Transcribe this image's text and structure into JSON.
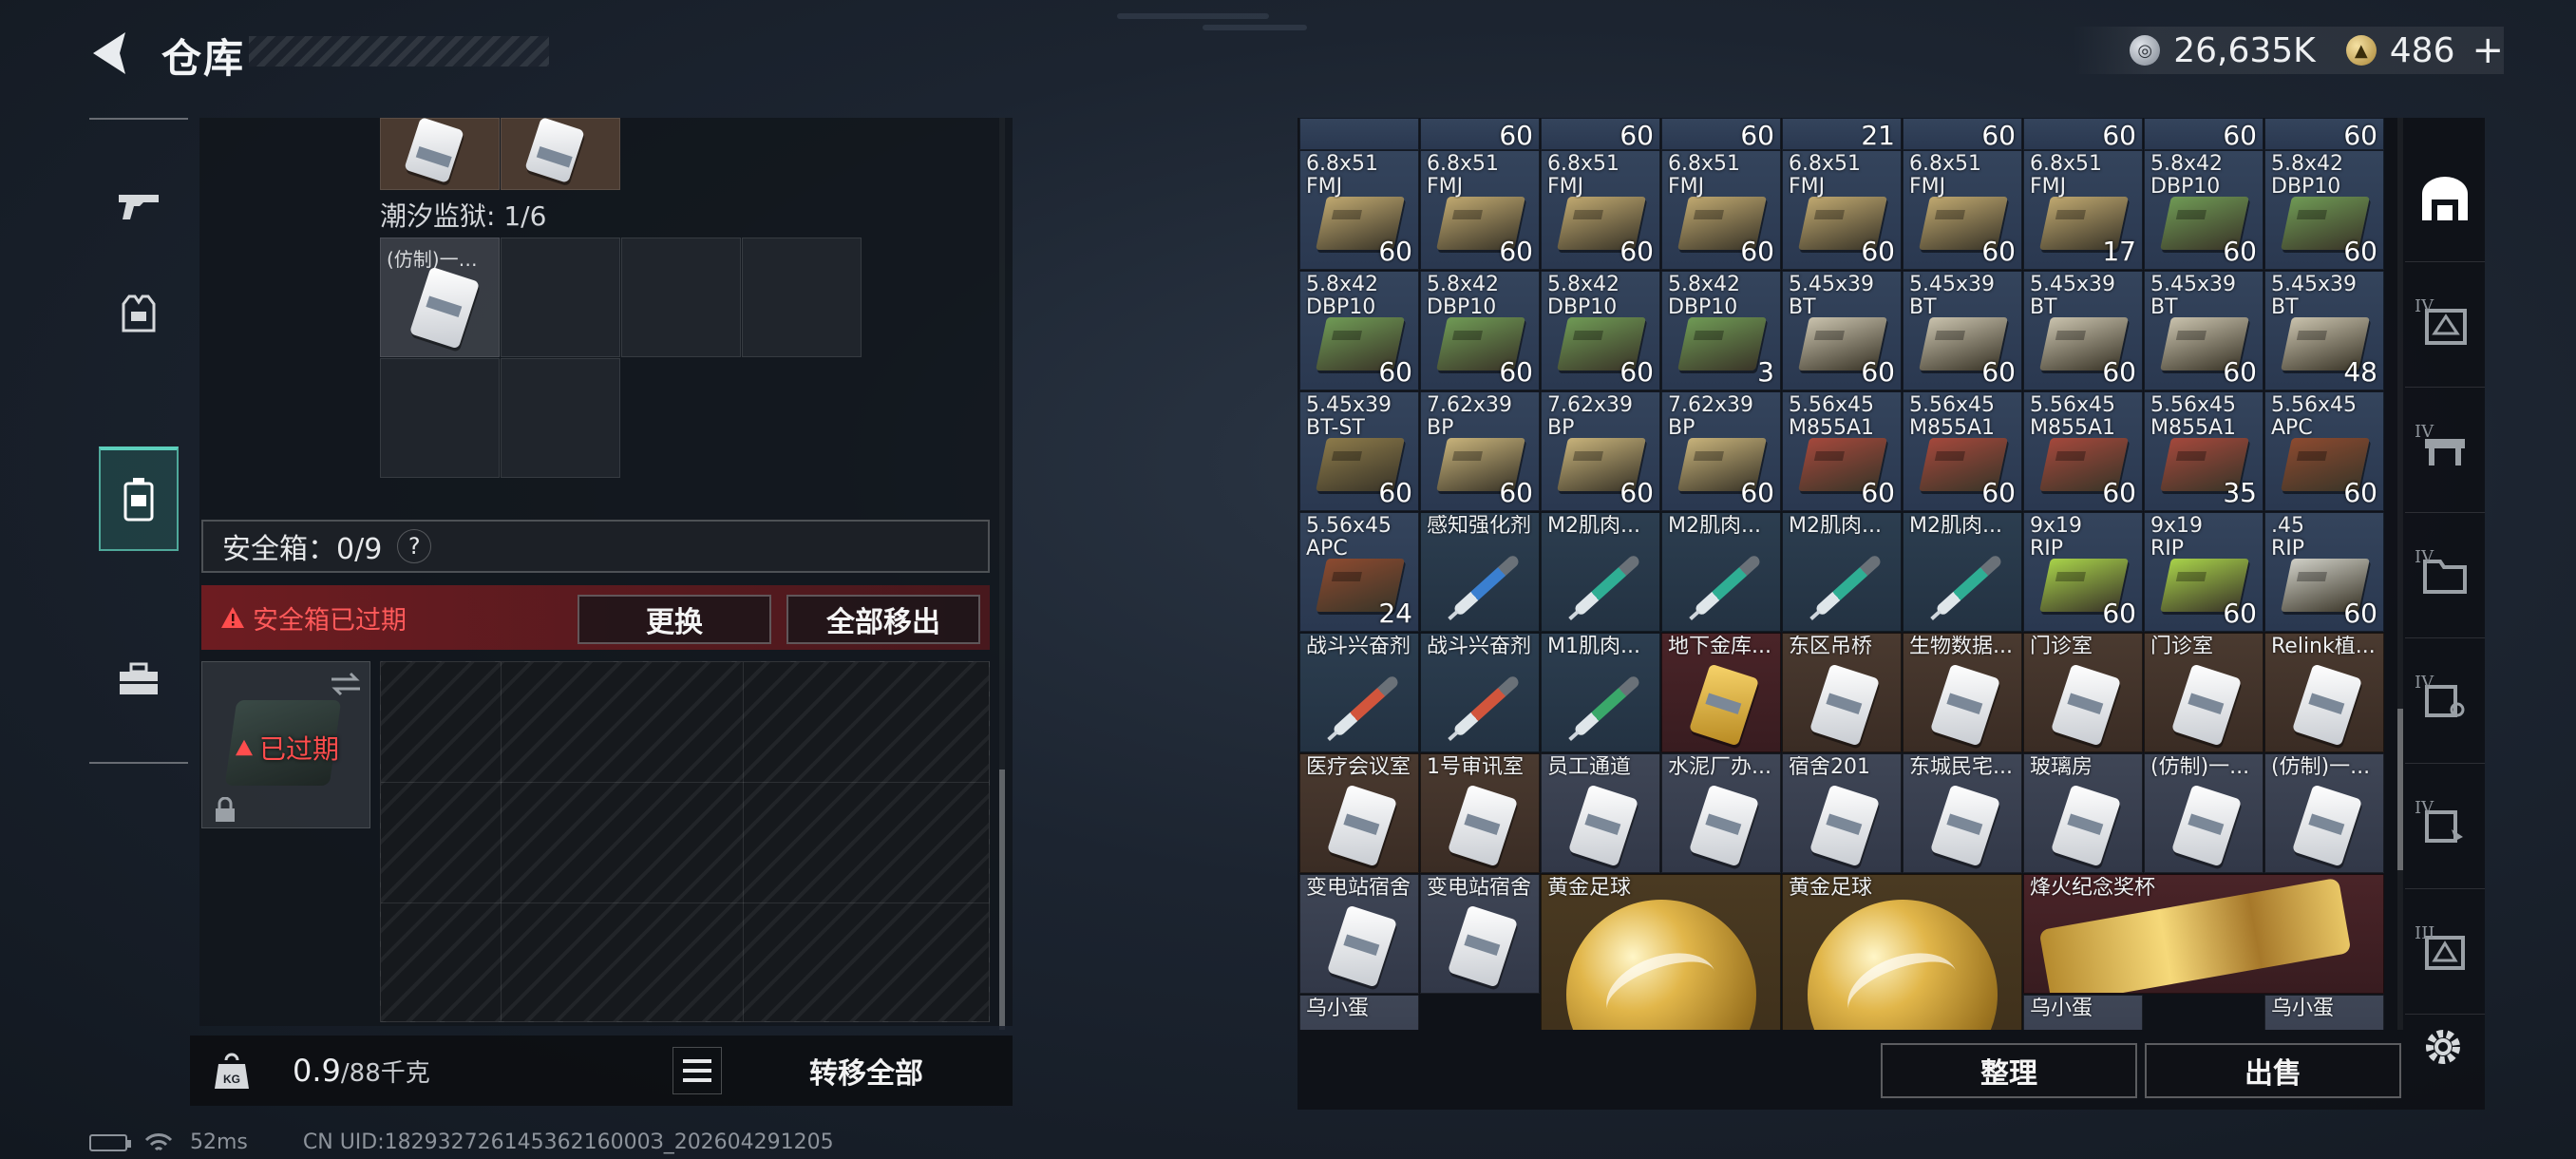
{
  "header": {
    "title": "仓库",
    "currencies": [
      {
        "icon": "silver-coin-icon",
        "symbol": "◎",
        "value": "26,635K"
      },
      {
        "icon": "gold-coin-icon",
        "symbol": "▲",
        "value": "486"
      }
    ],
    "plus_label": "+"
  },
  "left_sidebar": {
    "tabs": [
      {
        "icon": "gun-icon",
        "active": false
      },
      {
        "icon": "armor-vest-icon",
        "active": false
      },
      {
        "icon": "safe-box-icon",
        "active": true
      },
      {
        "icon": "toolbox-icon",
        "active": false
      }
    ]
  },
  "stash": {
    "prison_label": "潮汐监狱: 1/6",
    "prison_item_name": "(仿制)一…",
    "safebox_label": "安全箱：0/9",
    "help_label": "?",
    "expired_text": "安全箱已过期",
    "replace_button": "更换",
    "remove_all_button": "全部移出",
    "safebox_status": "已过期",
    "weight_value": "0.9",
    "weight_max": "/88千克",
    "transfer_all_button": "转移全部"
  },
  "status_bar": {
    "ping": "52ms",
    "uid": "CN UID:18293272614536216000З_202604291205"
  },
  "inventory": {
    "top_counts": [
      "",
      "60",
      "60",
      "60",
      "21",
      "60",
      "60",
      "60",
      "60"
    ],
    "rows": [
      [
        {
          "name": "6.8x51\nFMJ",
          "count": "60",
          "type": "ammo",
          "color": "#bfa870"
        },
        {
          "name": "6.8x51\nFMJ",
          "count": "60",
          "type": "ammo",
          "color": "#bfa870"
        },
        {
          "name": "6.8x51\nFMJ",
          "count": "60",
          "type": "ammo",
          "color": "#bfa870"
        },
        {
          "name": "6.8x51\nFMJ",
          "count": "60",
          "type": "ammo",
          "color": "#bfa870"
        },
        {
          "name": "6.8x51\nFMJ",
          "count": "60",
          "type": "ammo",
          "color": "#bfa870"
        },
        {
          "name": "6.8x51\nFMJ",
          "count": "60",
          "type": "ammo",
          "color": "#bfa870"
        },
        {
          "name": "6.8x51\nFMJ",
          "count": "17",
          "type": "ammo",
          "color": "#bfa870"
        },
        {
          "name": "5.8x42\nDBP10",
          "count": "60",
          "type": "ammo",
          "color": "#6f9a55"
        },
        {
          "name": "5.8x42\nDBP10",
          "count": "60",
          "type": "ammo",
          "color": "#6f9a55"
        }
      ],
      [
        {
          "name": "5.8x42\nDBP10",
          "count": "60",
          "type": "ammo",
          "color": "#6f9a55"
        },
        {
          "name": "5.8x42\nDBP10",
          "count": "60",
          "type": "ammo",
          "color": "#6f9a55"
        },
        {
          "name": "5.8x42\nDBP10",
          "count": "60",
          "type": "ammo",
          "color": "#6f9a55"
        },
        {
          "name": "5.8x42\nDBP10",
          "count": "3",
          "type": "ammo",
          "color": "#6f9a55"
        },
        {
          "name": "5.45x39\nBT",
          "count": "60",
          "type": "ammo",
          "color": "#c9c2ad"
        },
        {
          "name": "5.45x39\nBT",
          "count": "60",
          "type": "ammo",
          "color": "#c9c2ad"
        },
        {
          "name": "5.45x39\nBT",
          "count": "60",
          "type": "ammo",
          "color": "#c9c2ad"
        },
        {
          "name": "5.45x39\nBT",
          "count": "60",
          "type": "ammo",
          "color": "#c9c2ad"
        },
        {
          "name": "5.45x39\nBT",
          "count": "48",
          "type": "ammo",
          "color": "#c9c2ad"
        }
      ],
      [
        {
          "name": "5.45x39\nBT-ST",
          "count": "60",
          "type": "ammo",
          "color": "#8c7a4a"
        },
        {
          "name": "7.62x39\nBP",
          "count": "60",
          "type": "ammo",
          "color": "#c7b27a"
        },
        {
          "name": "7.62x39\nBP",
          "count": "60",
          "type": "ammo",
          "color": "#c7b27a"
        },
        {
          "name": "7.62x39\nBP",
          "count": "60",
          "type": "ammo",
          "color": "#c7b27a"
        },
        {
          "name": "5.56x45\nM855A1",
          "count": "60",
          "type": "ammo",
          "color": "#a4483c"
        },
        {
          "name": "5.56x45\nM855A1",
          "count": "60",
          "type": "ammo",
          "color": "#a4483c"
        },
        {
          "name": "5.56x45\nM855A1",
          "count": "60",
          "type": "ammo",
          "color": "#a4483c"
        },
        {
          "name": "5.56x45\nM855A1",
          "count": "35",
          "type": "ammo",
          "color": "#a4483c"
        },
        {
          "name": "5.56x45\nAPC",
          "count": "60",
          "type": "ammo",
          "color": "#8c4a30"
        }
      ],
      [
        {
          "name": "5.56x45\nAPC",
          "count": "24",
          "type": "ammo",
          "color": "#8c4a30"
        },
        {
          "name": "感知强化剂",
          "count": "",
          "type": "med",
          "color": "#3a7fd0"
        },
        {
          "name": "M2肌肉...",
          "count": "",
          "type": "med",
          "color": "#2fae94"
        },
        {
          "name": "M2肌肉...",
          "count": "",
          "type": "med",
          "color": "#2fae94"
        },
        {
          "name": "M2肌肉...",
          "count": "",
          "type": "med",
          "color": "#2fae94"
        },
        {
          "name": "M2肌肉...",
          "count": "",
          "type": "med",
          "color": "#2fae94"
        },
        {
          "name": "9x19\nRIP",
          "count": "60",
          "type": "ammo",
          "color": "#a8d24a"
        },
        {
          "name": "9x19\nRIP",
          "count": "60",
          "type": "ammo",
          "color": "#a8d24a"
        },
        {
          "name": ".45\nRIP",
          "count": "60",
          "type": "ammo",
          "color": "#cfcfc6"
        }
      ],
      [
        {
          "name": "战斗兴奋剂",
          "count": "",
          "type": "med",
          "color": "#d2553c"
        },
        {
          "name": "战斗兴奋剂",
          "count": "",
          "type": "med",
          "color": "#d2553c"
        },
        {
          "name": "M1肌肉...",
          "count": "",
          "type": "med",
          "color": "#3aa86a"
        },
        {
          "name": "地下金库...",
          "count": "",
          "type": "keyred",
          "color": "#e6c04a"
        },
        {
          "name": "东区吊桥",
          "count": "",
          "type": "key",
          "color": "#ffffff"
        },
        {
          "name": "生物数据...",
          "count": "",
          "type": "key",
          "color": "#ffffff"
        },
        {
          "name": "门诊室",
          "count": "",
          "type": "key",
          "color": "#ffffff"
        },
        {
          "name": "门诊室",
          "count": "",
          "type": "key",
          "color": "#ffffff"
        },
        {
          "name": "Relink植...",
          "count": "",
          "type": "key",
          "color": "#ffffff"
        }
      ],
      [
        {
          "name": "医疗会议室",
          "count": "",
          "type": "key",
          "color": "#ffffff"
        },
        {
          "name": "1号审讯室",
          "count": "",
          "type": "key",
          "color": "#ffffff"
        },
        {
          "name": "员工通道",
          "count": "",
          "type": "key2",
          "color": "#ffffff"
        },
        {
          "name": "水泥厂办...",
          "count": "",
          "type": "key2",
          "color": "#ffffff"
        },
        {
          "name": "宿舍201",
          "count": "",
          "type": "key2",
          "color": "#ffffff"
        },
        {
          "name": "东城民宅...",
          "count": "",
          "type": "key2",
          "color": "#ffffff"
        },
        {
          "name": "玻璃房",
          "count": "",
          "type": "key2",
          "color": "#ffffff"
        },
        {
          "name": "(仿制)一...",
          "count": "",
          "type": "key2",
          "color": "#ffffff"
        },
        {
          "name": "(仿制)一...",
          "count": "",
          "type": "key2",
          "color": "#ffffff"
        }
      ]
    ],
    "big_row": {
      "small_items": [
        {
          "name": "变电站宿舍"
        },
        {
          "name": "变电站宿舍"
        }
      ],
      "balls": [
        {
          "name": "黄金足球"
        },
        {
          "name": "黄金足球"
        }
      ],
      "trophy": {
        "name": "烽火纪念奖杯"
      }
    },
    "bottom_row": [
      "乌小蛋",
      "乌小蛋",
      "乌小蛋"
    ]
  },
  "right_sidebar": {
    "tabs": [
      {
        "icon": "warehouse-icon",
        "roman": "",
        "active": true
      },
      {
        "icon": "storage-expansion-icon",
        "roman": "IV"
      },
      {
        "icon": "workbench-icon",
        "roman": "IV"
      },
      {
        "icon": "folder-storage-icon",
        "roman": "IV"
      },
      {
        "icon": "key-storage-icon",
        "roman": "IV"
      },
      {
        "icon": "card-storage-icon",
        "roman": "IV"
      },
      {
        "icon": "container-storage-icon",
        "roman": "III"
      }
    ]
  },
  "actions": {
    "organize_button": "整理",
    "sell_button": "出售"
  }
}
